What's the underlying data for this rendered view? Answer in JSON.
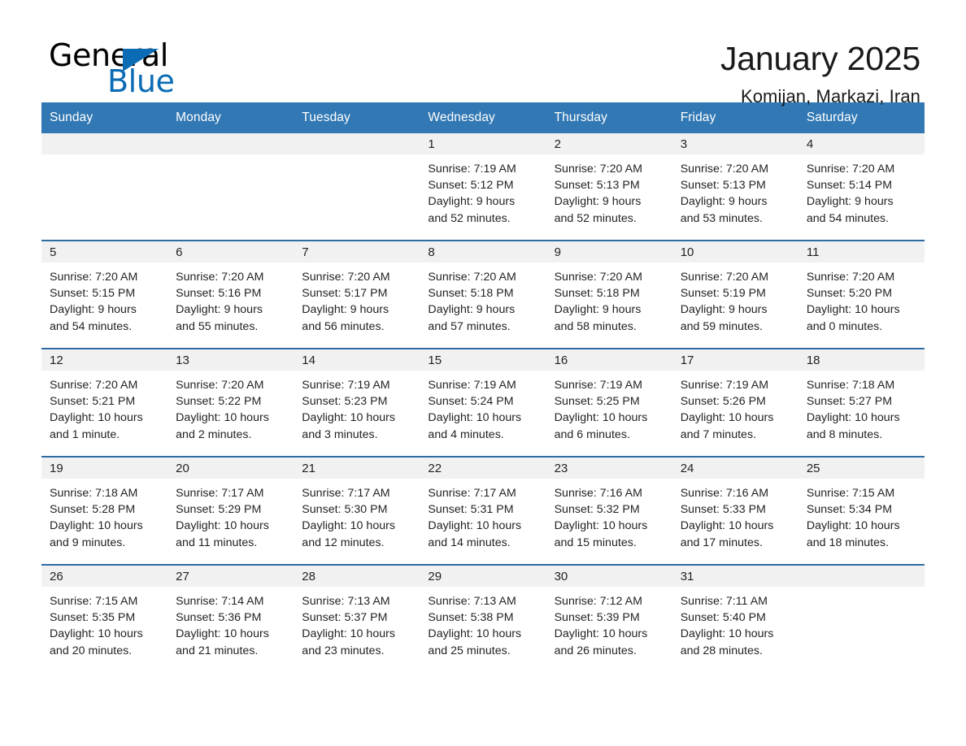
{
  "brand": {
    "name_primary": "General",
    "name_secondary": "Blue",
    "triangle_color": "#0b6cb5"
  },
  "header": {
    "title": "January 2025",
    "subtitle": "Komijan, Markazi, Iran"
  },
  "theme": {
    "header_blue": "#3178b4",
    "row_border_blue": "#2d6da4",
    "daynum_band": "#f1f1f1",
    "text": "#231f20"
  },
  "calendar": {
    "weekday_headers": [
      "Sunday",
      "Monday",
      "Tuesday",
      "Wednesday",
      "Thursday",
      "Friday",
      "Saturday"
    ],
    "weeks": [
      [
        {
          "day": "",
          "sunrise": "",
          "sunset": "",
          "daylight_line1": "",
          "daylight_line2": ""
        },
        {
          "day": "",
          "sunrise": "",
          "sunset": "",
          "daylight_line1": "",
          "daylight_line2": ""
        },
        {
          "day": "",
          "sunrise": "",
          "sunset": "",
          "daylight_line1": "",
          "daylight_line2": ""
        },
        {
          "day": "1",
          "sunrise": "Sunrise: 7:19 AM",
          "sunset": "Sunset: 5:12 PM",
          "daylight_line1": "Daylight: 9 hours",
          "daylight_line2": "and 52 minutes."
        },
        {
          "day": "2",
          "sunrise": "Sunrise: 7:20 AM",
          "sunset": "Sunset: 5:13 PM",
          "daylight_line1": "Daylight: 9 hours",
          "daylight_line2": "and 52 minutes."
        },
        {
          "day": "3",
          "sunrise": "Sunrise: 7:20 AM",
          "sunset": "Sunset: 5:13 PM",
          "daylight_line1": "Daylight: 9 hours",
          "daylight_line2": "and 53 minutes."
        },
        {
          "day": "4",
          "sunrise": "Sunrise: 7:20 AM",
          "sunset": "Sunset: 5:14 PM",
          "daylight_line1": "Daylight: 9 hours",
          "daylight_line2": "and 54 minutes."
        }
      ],
      [
        {
          "day": "5",
          "sunrise": "Sunrise: 7:20 AM",
          "sunset": "Sunset: 5:15 PM",
          "daylight_line1": "Daylight: 9 hours",
          "daylight_line2": "and 54 minutes."
        },
        {
          "day": "6",
          "sunrise": "Sunrise: 7:20 AM",
          "sunset": "Sunset: 5:16 PM",
          "daylight_line1": "Daylight: 9 hours",
          "daylight_line2": "and 55 minutes."
        },
        {
          "day": "7",
          "sunrise": "Sunrise: 7:20 AM",
          "sunset": "Sunset: 5:17 PM",
          "daylight_line1": "Daylight: 9 hours",
          "daylight_line2": "and 56 minutes."
        },
        {
          "day": "8",
          "sunrise": "Sunrise: 7:20 AM",
          "sunset": "Sunset: 5:18 PM",
          "daylight_line1": "Daylight: 9 hours",
          "daylight_line2": "and 57 minutes."
        },
        {
          "day": "9",
          "sunrise": "Sunrise: 7:20 AM",
          "sunset": "Sunset: 5:18 PM",
          "daylight_line1": "Daylight: 9 hours",
          "daylight_line2": "and 58 minutes."
        },
        {
          "day": "10",
          "sunrise": "Sunrise: 7:20 AM",
          "sunset": "Sunset: 5:19 PM",
          "daylight_line1": "Daylight: 9 hours",
          "daylight_line2": "and 59 minutes."
        },
        {
          "day": "11",
          "sunrise": "Sunrise: 7:20 AM",
          "sunset": "Sunset: 5:20 PM",
          "daylight_line1": "Daylight: 10 hours",
          "daylight_line2": "and 0 minutes."
        }
      ],
      [
        {
          "day": "12",
          "sunrise": "Sunrise: 7:20 AM",
          "sunset": "Sunset: 5:21 PM",
          "daylight_line1": "Daylight: 10 hours",
          "daylight_line2": "and 1 minute."
        },
        {
          "day": "13",
          "sunrise": "Sunrise: 7:20 AM",
          "sunset": "Sunset: 5:22 PM",
          "daylight_line1": "Daylight: 10 hours",
          "daylight_line2": "and 2 minutes."
        },
        {
          "day": "14",
          "sunrise": "Sunrise: 7:19 AM",
          "sunset": "Sunset: 5:23 PM",
          "daylight_line1": "Daylight: 10 hours",
          "daylight_line2": "and 3 minutes."
        },
        {
          "day": "15",
          "sunrise": "Sunrise: 7:19 AM",
          "sunset": "Sunset: 5:24 PM",
          "daylight_line1": "Daylight: 10 hours",
          "daylight_line2": "and 4 minutes."
        },
        {
          "day": "16",
          "sunrise": "Sunrise: 7:19 AM",
          "sunset": "Sunset: 5:25 PM",
          "daylight_line1": "Daylight: 10 hours",
          "daylight_line2": "and 6 minutes."
        },
        {
          "day": "17",
          "sunrise": "Sunrise: 7:19 AM",
          "sunset": "Sunset: 5:26 PM",
          "daylight_line1": "Daylight: 10 hours",
          "daylight_line2": "and 7 minutes."
        },
        {
          "day": "18",
          "sunrise": "Sunrise: 7:18 AM",
          "sunset": "Sunset: 5:27 PM",
          "daylight_line1": "Daylight: 10 hours",
          "daylight_line2": "and 8 minutes."
        }
      ],
      [
        {
          "day": "19",
          "sunrise": "Sunrise: 7:18 AM",
          "sunset": "Sunset: 5:28 PM",
          "daylight_line1": "Daylight: 10 hours",
          "daylight_line2": "and 9 minutes."
        },
        {
          "day": "20",
          "sunrise": "Sunrise: 7:17 AM",
          "sunset": "Sunset: 5:29 PM",
          "daylight_line1": "Daylight: 10 hours",
          "daylight_line2": "and 11 minutes."
        },
        {
          "day": "21",
          "sunrise": "Sunrise: 7:17 AM",
          "sunset": "Sunset: 5:30 PM",
          "daylight_line1": "Daylight: 10 hours",
          "daylight_line2": "and 12 minutes."
        },
        {
          "day": "22",
          "sunrise": "Sunrise: 7:17 AM",
          "sunset": "Sunset: 5:31 PM",
          "daylight_line1": "Daylight: 10 hours",
          "daylight_line2": "and 14 minutes."
        },
        {
          "day": "23",
          "sunrise": "Sunrise: 7:16 AM",
          "sunset": "Sunset: 5:32 PM",
          "daylight_line1": "Daylight: 10 hours",
          "daylight_line2": "and 15 minutes."
        },
        {
          "day": "24",
          "sunrise": "Sunrise: 7:16 AM",
          "sunset": "Sunset: 5:33 PM",
          "daylight_line1": "Daylight: 10 hours",
          "daylight_line2": "and 17 minutes."
        },
        {
          "day": "25",
          "sunrise": "Sunrise: 7:15 AM",
          "sunset": "Sunset: 5:34 PM",
          "daylight_line1": "Daylight: 10 hours",
          "daylight_line2": "and 18 minutes."
        }
      ],
      [
        {
          "day": "26",
          "sunrise": "Sunrise: 7:15 AM",
          "sunset": "Sunset: 5:35 PM",
          "daylight_line1": "Daylight: 10 hours",
          "daylight_line2": "and 20 minutes."
        },
        {
          "day": "27",
          "sunrise": "Sunrise: 7:14 AM",
          "sunset": "Sunset: 5:36 PM",
          "daylight_line1": "Daylight: 10 hours",
          "daylight_line2": "and 21 minutes."
        },
        {
          "day": "28",
          "sunrise": "Sunrise: 7:13 AM",
          "sunset": "Sunset: 5:37 PM",
          "daylight_line1": "Daylight: 10 hours",
          "daylight_line2": "and 23 minutes."
        },
        {
          "day": "29",
          "sunrise": "Sunrise: 7:13 AM",
          "sunset": "Sunset: 5:38 PM",
          "daylight_line1": "Daylight: 10 hours",
          "daylight_line2": "and 25 minutes."
        },
        {
          "day": "30",
          "sunrise": "Sunrise: 7:12 AM",
          "sunset": "Sunset: 5:39 PM",
          "daylight_line1": "Daylight: 10 hours",
          "daylight_line2": "and 26 minutes."
        },
        {
          "day": "31",
          "sunrise": "Sunrise: 7:11 AM",
          "sunset": "Sunset: 5:40 PM",
          "daylight_line1": "Daylight: 10 hours",
          "daylight_line2": "and 28 minutes."
        },
        {
          "day": "",
          "sunrise": "",
          "sunset": "",
          "daylight_line1": "",
          "daylight_line2": ""
        }
      ]
    ]
  }
}
